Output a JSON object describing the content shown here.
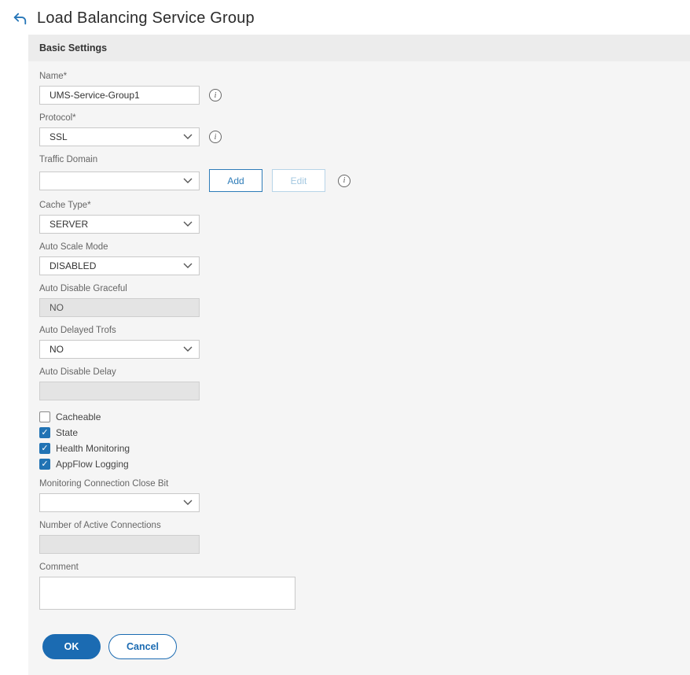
{
  "page": {
    "title": "Load Balancing Service Group"
  },
  "panel": {
    "header": "Basic Settings"
  },
  "fields": {
    "name": {
      "label": "Name*",
      "value": "UMS-Service-Group1"
    },
    "protocol": {
      "label": "Protocol*",
      "value": "SSL"
    },
    "traffic_domain": {
      "label": "Traffic Domain",
      "value": "",
      "add_label": "Add",
      "edit_label": "Edit"
    },
    "cache_type": {
      "label": "Cache Type*",
      "value": "SERVER"
    },
    "auto_scale_mode": {
      "label": "Auto Scale Mode",
      "value": "DISABLED"
    },
    "auto_disable_graceful": {
      "label": "Auto Disable Graceful",
      "value": "NO"
    },
    "auto_delayed_trofs": {
      "label": "Auto Delayed Trofs",
      "value": "NO"
    },
    "auto_disable_delay": {
      "label": "Auto Disable Delay",
      "value": ""
    },
    "monitoring_connection_close_bit": {
      "label": "Monitoring Connection Close Bit",
      "value": ""
    },
    "number_of_active_connections": {
      "label": "Number of Active Connections",
      "value": ""
    },
    "comment": {
      "label": "Comment",
      "value": ""
    }
  },
  "checkboxes": [
    {
      "label": "Cacheable",
      "checked": false
    },
    {
      "label": "State",
      "checked": true
    },
    {
      "label": "Health Monitoring",
      "checked": true
    },
    {
      "label": "AppFlow Logging",
      "checked": true
    }
  ],
  "footer": {
    "ok_label": "OK",
    "cancel_label": "Cancel"
  },
  "icons": {
    "info": "i",
    "check": "✓"
  },
  "colors": {
    "accent_blue": "#1b6bb2",
    "outline_blue": "#2e7cb8",
    "checkbox_blue": "#2173b4",
    "panel_background": "#f5f5f5",
    "panel_header_background": "#ececec",
    "disabled_input_background": "#e4e4e4"
  }
}
